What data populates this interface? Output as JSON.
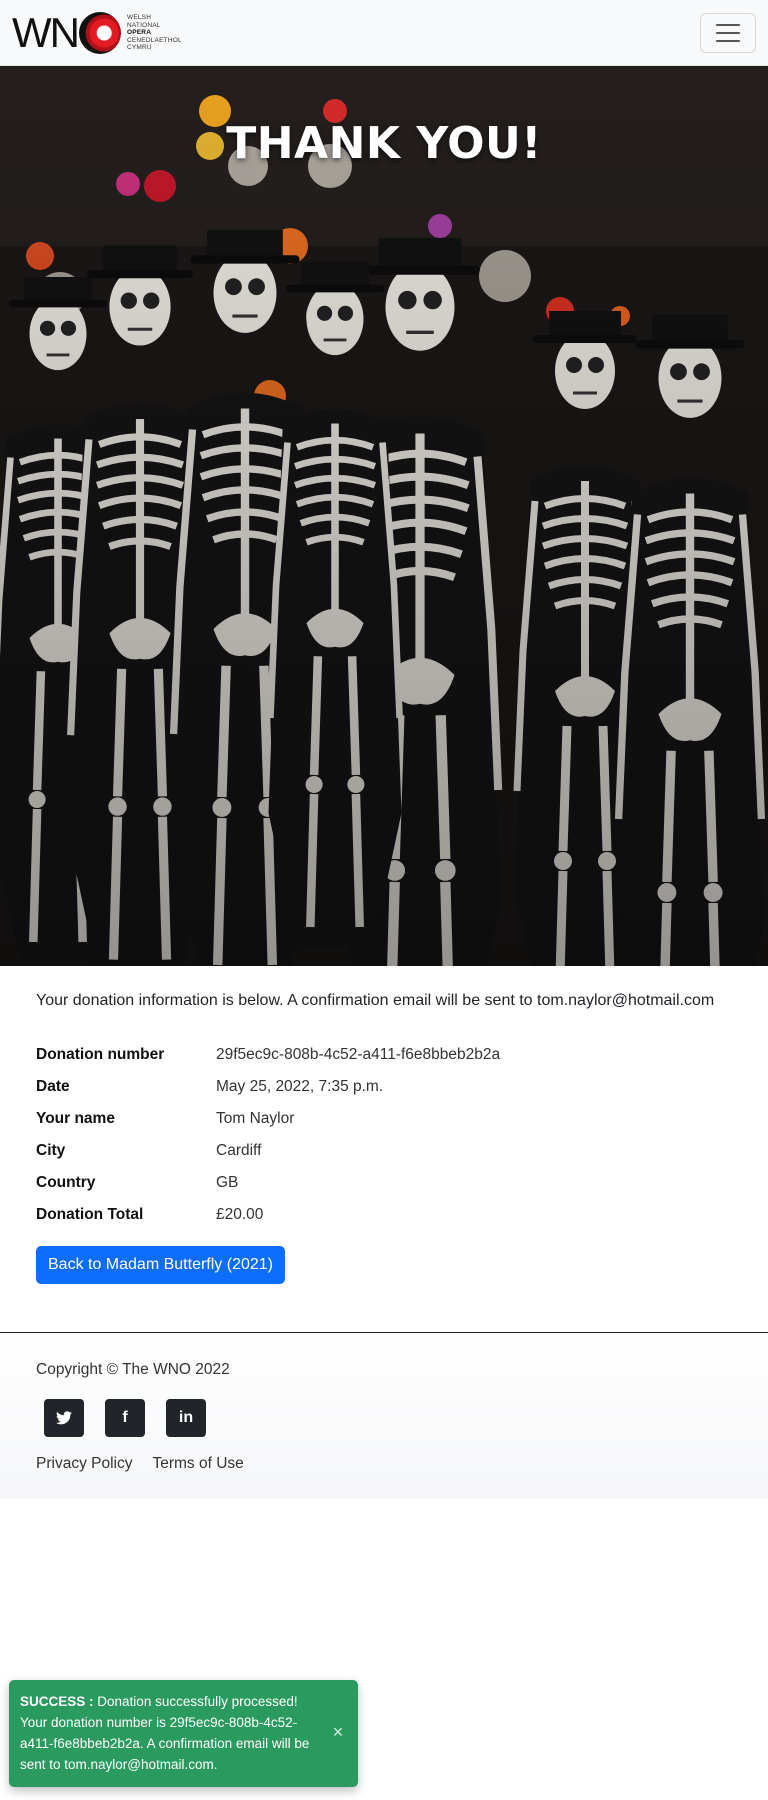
{
  "brand": {
    "wordmark": "WN",
    "subtitle_lines": [
      "WELSH",
      "NATIONAL",
      "OPERA",
      "CENEDLAETHOL",
      "CYMRU"
    ],
    "accent_color": "#e31b23"
  },
  "navbar": {
    "toggle_icon": "hamburger-menu-icon"
  },
  "hero": {
    "title": "THANK YOU!"
  },
  "main": {
    "intro": "Your donation information is below. A confirmation email will be sent to tom.naylor@hotmail.com",
    "details": [
      {
        "label": "Donation number",
        "value": "29f5ec9c-808b-4c52-a411-f6e8bbeb2b2a"
      },
      {
        "label": "Date",
        "value": "May 25, 2022, 7:35 p.m."
      },
      {
        "label": "Your name",
        "value": "Tom Naylor"
      },
      {
        "label": "City",
        "value": "Cardiff"
      },
      {
        "label": "Country",
        "value": "GB"
      },
      {
        "label": "Donation Total",
        "value": "£20.00"
      }
    ],
    "back_button": "Back to Madam Butterfly (2021)",
    "button_color": "#0d6efd"
  },
  "footer": {
    "copyright": "Copyright © The WNO 2022",
    "socials": [
      {
        "icon": "twitter-icon",
        "glyph": "🐦"
      },
      {
        "icon": "facebook-icon",
        "glyph": "f"
      },
      {
        "icon": "linkedin-icon",
        "glyph": "in"
      }
    ],
    "links": [
      "Privacy Policy",
      "Terms of Use"
    ]
  },
  "toast": {
    "title": "SUCCESS :",
    "message": "Donation successfully processed! Your donation number is 29f5ec9c-808b-4c52-a411-f6e8bbeb2b2a. A confirmation email will be sent to tom.naylor@hotmail.com.",
    "close": "×",
    "color": "#2a9a5e"
  }
}
